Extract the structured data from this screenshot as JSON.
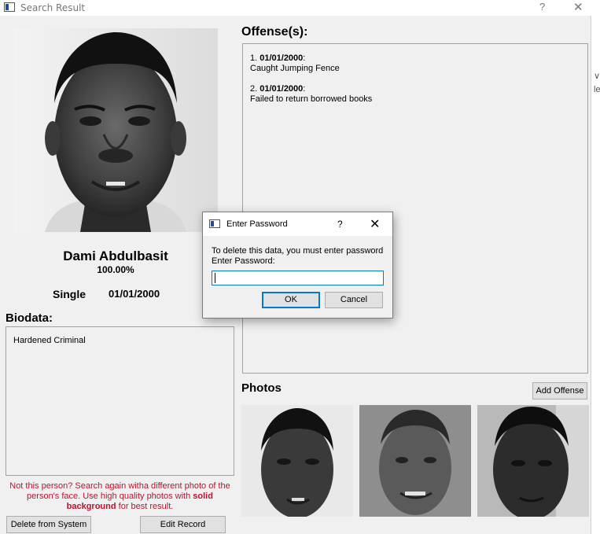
{
  "window": {
    "title": "Search Result",
    "help_glyph": "?",
    "close_glyph": "✕"
  },
  "person": {
    "name": "Dami Abdulbasit",
    "match": "100.00%",
    "status": "Single",
    "dob": "01/01/2000"
  },
  "biodata": {
    "label": "Biodata:",
    "text": "Hardened Criminal"
  },
  "warning": {
    "part1": "Not this person? Search again witha different photo of the person's face. Use high quality photos with ",
    "bold": "solid background",
    "part2": " for best result."
  },
  "buttons": {
    "delete": "Delete from System",
    "edit": "Edit Record",
    "add_offense": "Add Offense"
  },
  "offenses": {
    "label": "Offense(s):",
    "items": [
      {
        "num": "1. ",
        "date": "01/01/2000",
        "desc": "Caught Jumping Fence"
      },
      {
        "num": "2. ",
        "date": "01/01/2000",
        "desc": "Failed to return borrowed books"
      }
    ]
  },
  "photos": {
    "label": "Photos"
  },
  "dialog": {
    "title": "Enter Password",
    "help_glyph": "?",
    "close_glyph": "✕",
    "message_line1": "To delete this data, you must enter password",
    "message_line2": "Enter Password:",
    "password_value": "",
    "ok_label": "OK",
    "cancel_label": "Cancel"
  },
  "icons": {
    "app": "window-app-icon",
    "dialog": "dialog-app-icon"
  },
  "colors": {
    "warning_text": "#c0102c",
    "focus_accent": "#0078d7"
  }
}
